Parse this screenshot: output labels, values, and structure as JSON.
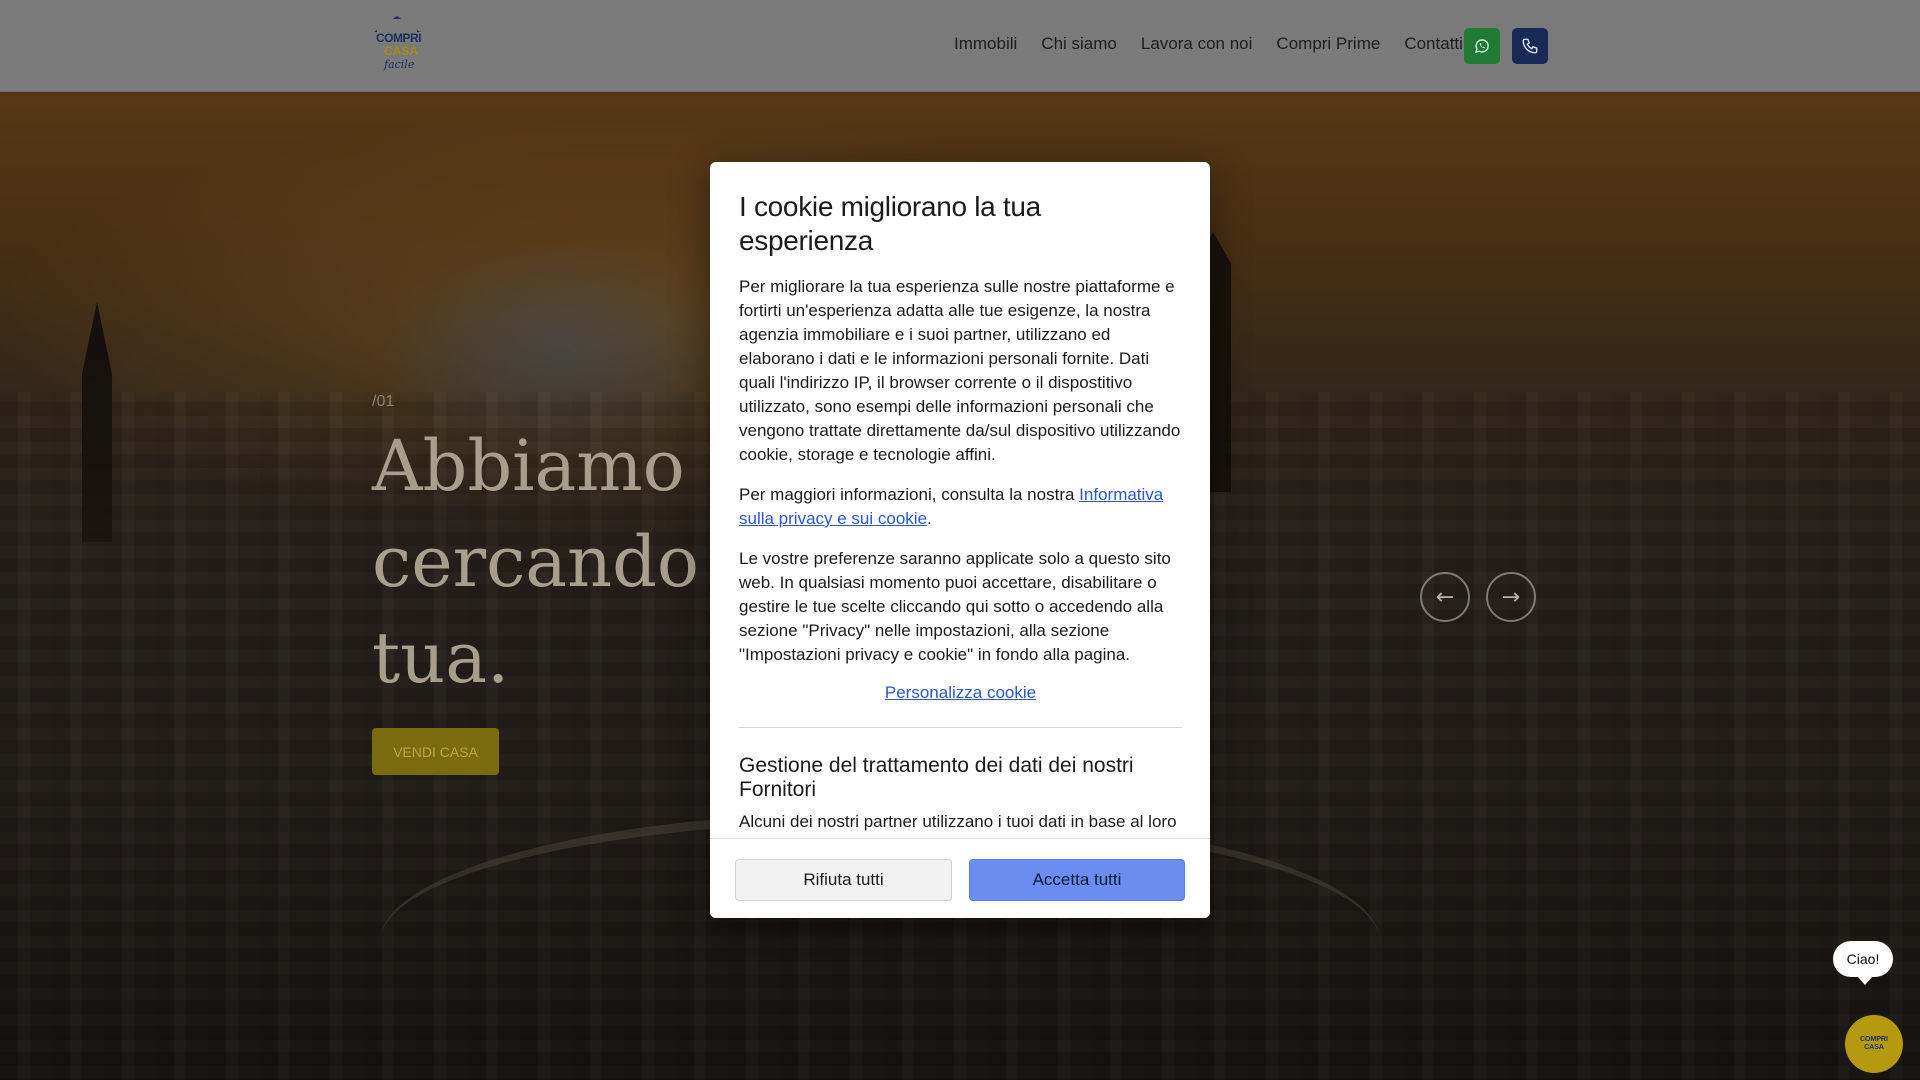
{
  "header": {
    "logo": {
      "line1": "COMPRI",
      "line2": "CASA",
      "line3": "facile"
    },
    "nav": [
      {
        "label": "Immobili"
      },
      {
        "label": "Chi siamo"
      },
      {
        "label": "Lavora con noi"
      },
      {
        "label": "Compri Prime"
      },
      {
        "label": "Contatti"
      }
    ],
    "icons": {
      "whatsapp": "whatsapp-icon",
      "phone": "phone-icon"
    },
    "colors": {
      "whatsapp": "#1e7a35",
      "phone": "#182a55"
    }
  },
  "hero": {
    "slide_number": "/01",
    "title": "Abbiamo già la casa che stai cercando, o vogliamo la tua.",
    "visible_title_lines": [
      "Abbiamo g",
      "cercando ca",
      "tua."
    ],
    "cta_label": "VENDI CASA",
    "prev_arrow": "←",
    "next_arrow": "→"
  },
  "cookie_modal": {
    "title": "I cookie migliorano la tua esperienza",
    "paragraph1": "Per migliorare la tua esperienza sulle nostre piattaforme e fortirti un'esperienza adatta alle tue esigenze, la nostra agenzia immobiliare e i suoi partner, utilizzano ed elaborano i dati e le informazioni personali fornite. Dati quali l'indirizzo IP, il browser corrente o il dispostitivo utilizzato, sono esempi delle informazioni personali che vengono trattate direttamente da/sul dispositivo utilizzando cookie, storage e tecnologie affini.",
    "paragraph2_prefix": "Per maggiori informazioni, consulta la nostra ",
    "paragraph2_link": "Informativa sulla privacy e sui cookie",
    "paragraph2_suffix": ".",
    "paragraph3": "Le vostre preferenze saranno applicate solo a questo sito web. In qualsiasi momento puoi accettare, disabilitare o gestire le tue scelte cliccando qui sotto o accedendo alla sezione \"Privacy\" nelle impostazioni, alla sezione \"Impostazioni privacy e cookie\" in fondo alla pagina.",
    "customize_link": "Personalizza cookie",
    "section_title": "Gestione del trattamento dei dati dei nostri Fornitori",
    "section_text": "Alcuni dei nostri partner utilizzano i tuoi dati in base al loro legittimo interesse. Potete opporvi a tale trattamento in qualsiasi momento. È possibile consultare i dettagli",
    "reject_label": "Rifiuta tutti",
    "accept_label": "Accetta tutti",
    "colors": {
      "accept": "#6b8df0",
      "link": "#2c56c9"
    }
  },
  "chat": {
    "greeting": "Ciao!",
    "launcher_icon": "compri-casa-logo-icon"
  }
}
